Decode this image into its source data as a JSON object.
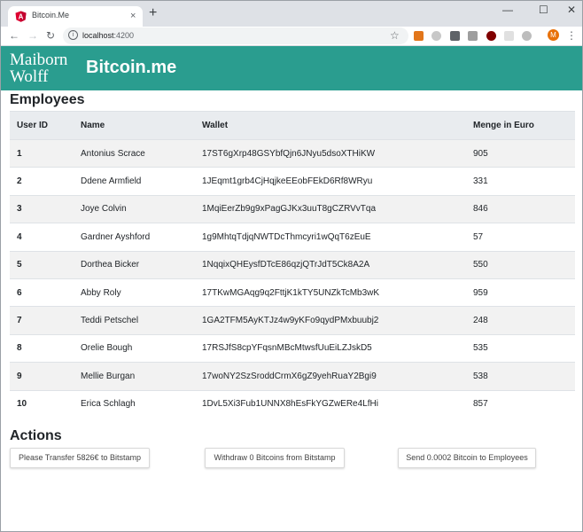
{
  "browser": {
    "tab_title": "Bitcoin.Me",
    "tab_close": "×",
    "new_tab": "+",
    "url_host": "localhost",
    "url_port": ":4200",
    "back": "←",
    "forward": "→",
    "reload": "↻",
    "star": "☆",
    "profile_initial": "M",
    "menu": "⋮",
    "minimize": "—",
    "maximize": "☐",
    "close": "✕"
  },
  "app": {
    "logo_line1": "Maiborn",
    "logo_line2": "Wolff",
    "brand": "Bitcoin.me",
    "accent": "#2a9d8f"
  },
  "employees": {
    "title": "Employees",
    "columns": [
      "User ID",
      "Name",
      "Wallet",
      "Menge in Euro"
    ],
    "rows": [
      {
        "id": "1",
        "name": "Antonius Scrace",
        "wallet": "17ST6gXrp48GSYbfQjn6JNyu5dsoXTHiKW",
        "amount": "905"
      },
      {
        "id": "2",
        "name": "Ddene Armfield",
        "wallet": "1JEqmt1grb4CjHqjkeEEobFEkD6Rf8WRyu",
        "amount": "331"
      },
      {
        "id": "3",
        "name": "Joye Colvin",
        "wallet": "1MqiEerZb9g9xPagGJKx3uuT8gCZRVvTqa",
        "amount": "846"
      },
      {
        "id": "4",
        "name": "Gardner Ayshford",
        "wallet": "1g9MhtqTdjqNWTDcThmcyri1wQqT6zEuE",
        "amount": "57"
      },
      {
        "id": "5",
        "name": "Dorthea Bicker",
        "wallet": "1NqqixQHEysfDTcE86qzjQTrJdT5Ck8A2A",
        "amount": "550"
      },
      {
        "id": "6",
        "name": "Abby Roly",
        "wallet": "17TKwMGAqg9q2FttjK1kTY5UNZkTcMb3wK",
        "amount": "959"
      },
      {
        "id": "7",
        "name": "Teddi Petschel",
        "wallet": "1GA2TFM5AyKTJz4w9yKFo9qydPMxbuubj2",
        "amount": "248"
      },
      {
        "id": "8",
        "name": "Orelie Bough",
        "wallet": "17RSJfS8cpYFqsnMBcMtwsfUuEiLZJskD5",
        "amount": "535"
      },
      {
        "id": "9",
        "name": "Mellie Burgan",
        "wallet": "17woNY2SzSroddCrmX6gZ9yehRuaY2Bgi9",
        "amount": "538"
      },
      {
        "id": "10",
        "name": "Erica Schlagh",
        "wallet": "1DvL5Xi3Fub1UNNX8hEsFkYGZwERe4LfHi",
        "amount": "857"
      }
    ]
  },
  "actions": {
    "title": "Actions",
    "transfer_label": "Please Transfer 5826€ to Bitstamp",
    "withdraw_label": "Withdraw 0 Bitcoins from Bitstamp",
    "send_label": "Send 0.0002 Bitcoin to Employees"
  }
}
